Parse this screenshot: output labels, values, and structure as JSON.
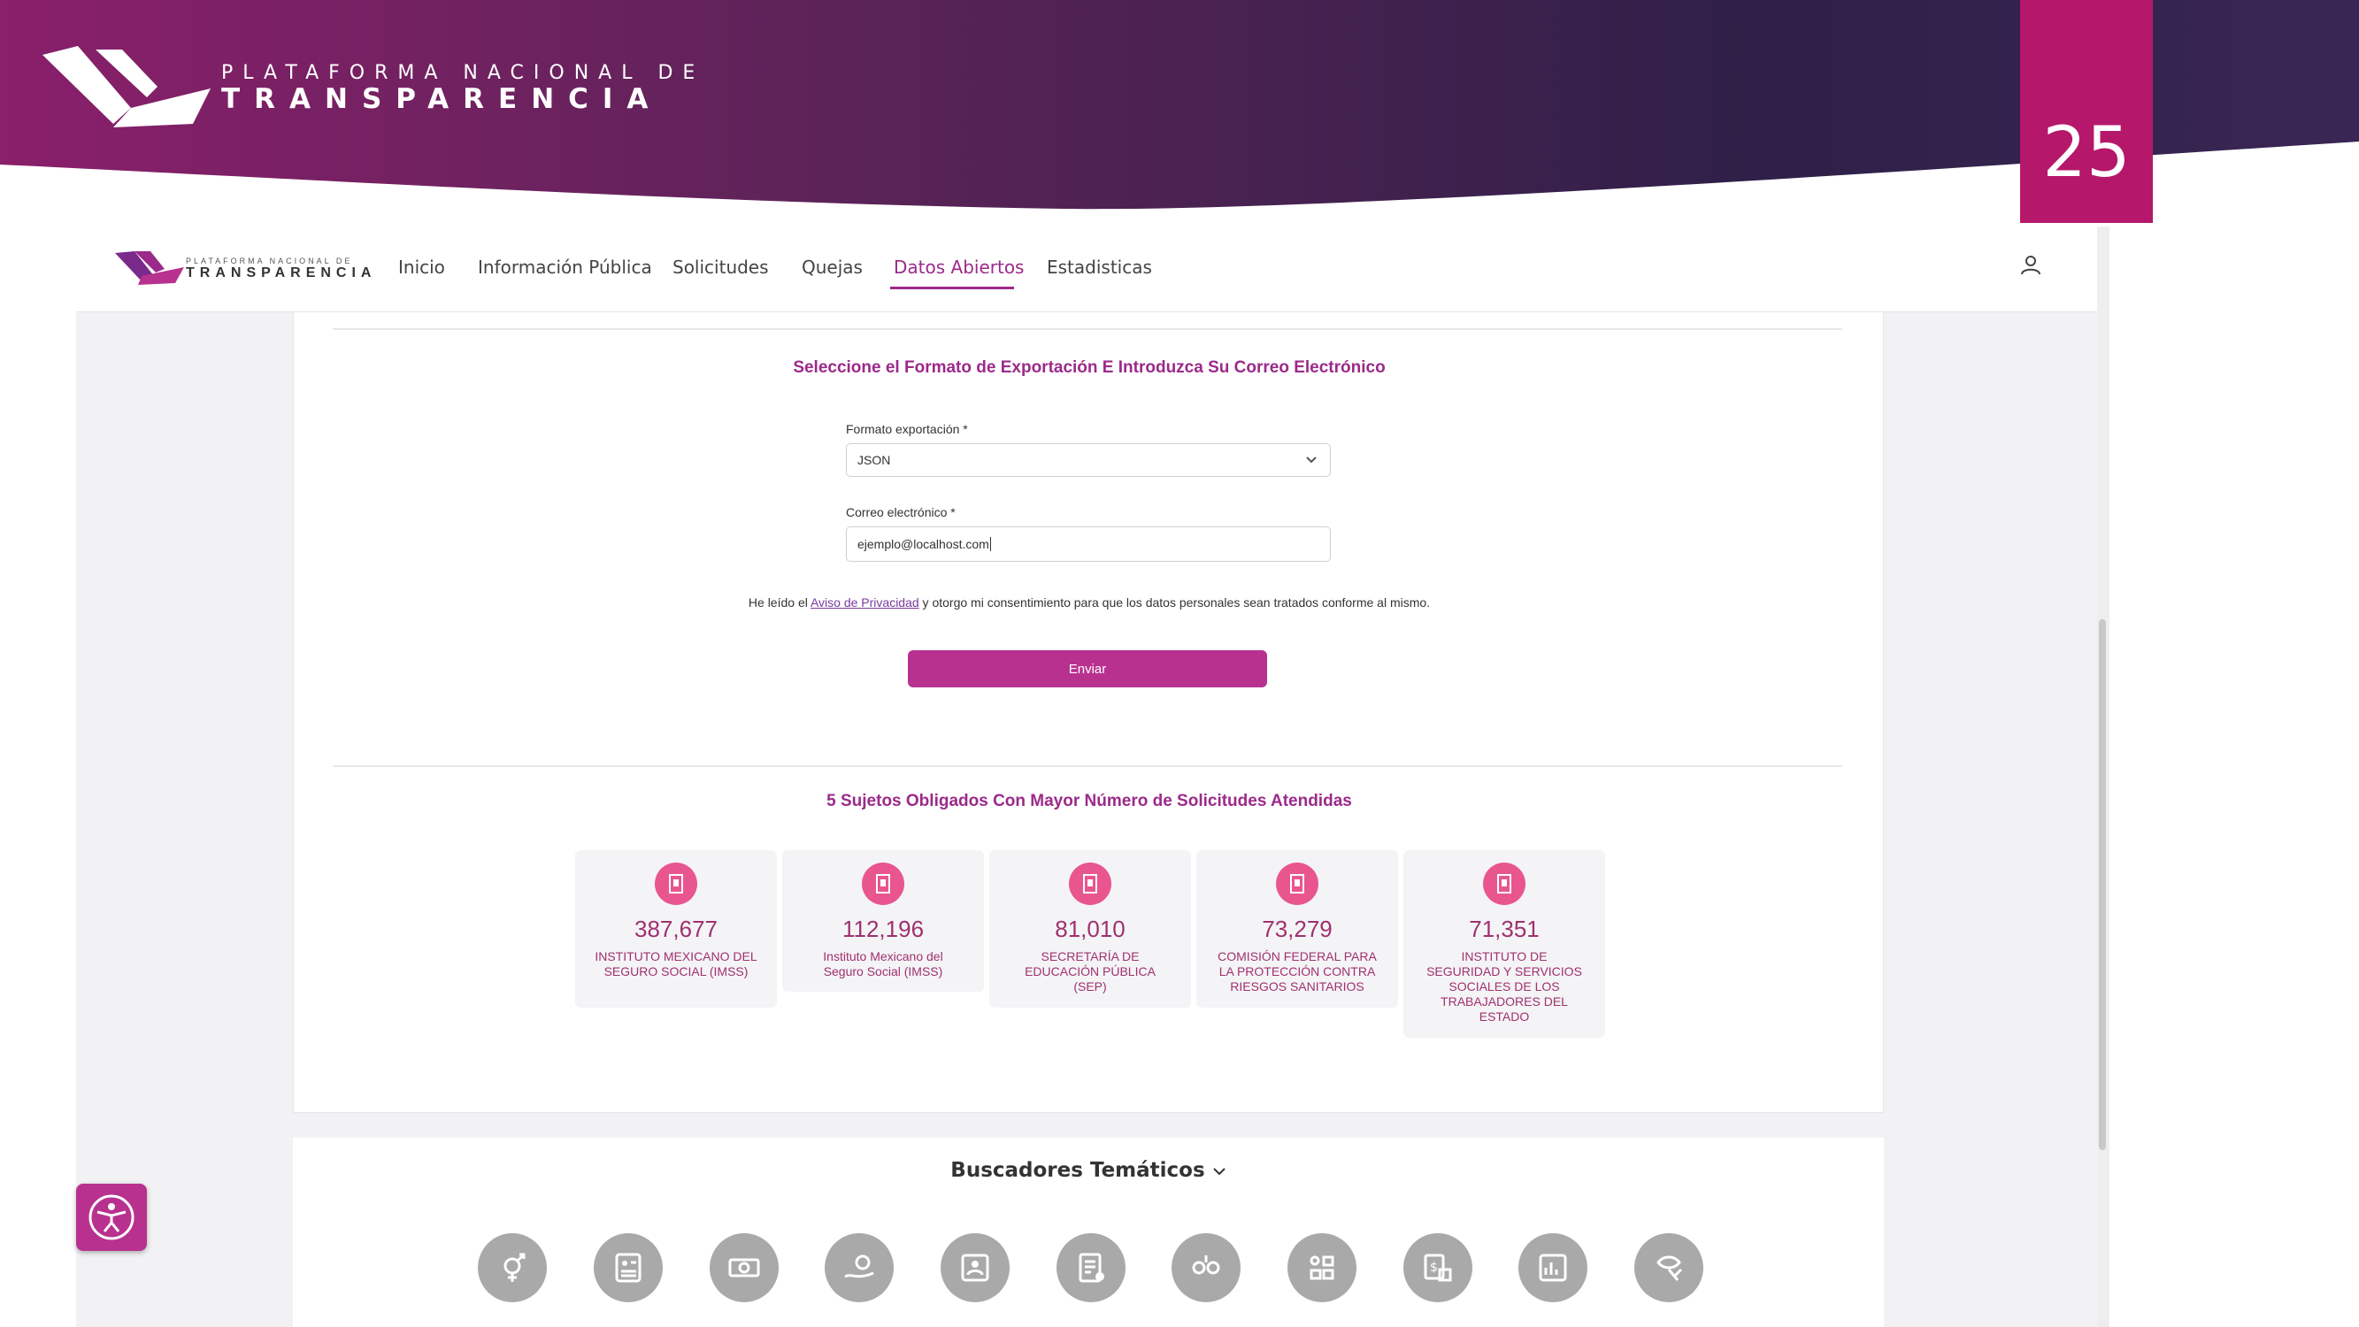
{
  "slide": {
    "brand_small": "PLATAFORMA NACIONAL DE",
    "brand_big": "TRANSPARENCIA",
    "page_number": "25",
    "colors": {
      "banner_dark": "#2e2048",
      "banner_magenta": "#8a1f6b",
      "page_badge": "#b5186b"
    }
  },
  "nav": {
    "logo_small": "PLATAFORMA NACIONAL DE",
    "logo_big": "TRANSPARENCIA",
    "items": [
      {
        "label": "Inicio",
        "active": false
      },
      {
        "label": "Información Pública",
        "active": false
      },
      {
        "label": "Solicitudes",
        "active": false
      },
      {
        "label": "Quejas",
        "active": false
      },
      {
        "label": "Datos Abiertos",
        "active": true
      },
      {
        "label": "Estadisticas",
        "active": false
      }
    ],
    "user_icon": "user-icon"
  },
  "export_form": {
    "title": "Seleccione el Formato de Exportación E Introduzca Su Correo Electrónico",
    "format_label": "Formato exportación *",
    "format_value": "JSON",
    "email_label": "Correo electrónico *",
    "email_value": "ejemplo@localhost.com",
    "consent_before": "He leído el ",
    "consent_link": "Aviso de Privacidad",
    "consent_after": " y otorgo mi consentimiento para que los datos personales sean tratados conforme al mismo.",
    "submit_label": "Enviar"
  },
  "top_subjects": {
    "title": "5 Sujetos Obligados Con Mayor Número de Solicitudes Atendidas",
    "items": [
      {
        "value": "387,677",
        "name": "INSTITUTO MEXICANO DEL SEGURO SOCIAL (IMSS)"
      },
      {
        "value": "112,196",
        "name": "Instituto Mexicano del Seguro Social (IMSS)"
      },
      {
        "value": "81,010",
        "name": "SECRETARÍA DE EDUCACIÓN PÚBLICA (SEP)"
      },
      {
        "value": "73,279",
        "name": "COMISIÓN FEDERAL PARA LA PROTECCIÓN CONTRA RIESGOS SANITARIOS"
      },
      {
        "value": "71,351",
        "name": "INSTITUTO DE SEGURIDAD Y SERVICIOS SOCIALES DE LOS TRABAJADORES DEL ESTADO"
      }
    ]
  },
  "buscadores": {
    "title": "Buscadores Temáticos",
    "icons": [
      "gender-icon",
      "directory-icon",
      "money-icon",
      "services-icon",
      "officials-icon",
      "contracts-icon",
      "budget-icon",
      "organization-icon",
      "payments-icon",
      "statistics-icon",
      "justice-icon"
    ]
  },
  "accessibility_icon": "accessibility-icon"
}
